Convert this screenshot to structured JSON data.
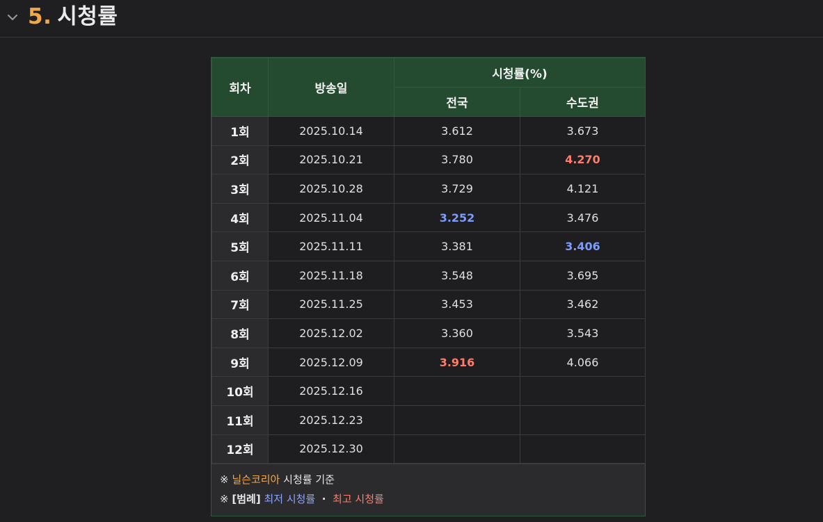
{
  "section": {
    "number": "5.",
    "title": "시청률"
  },
  "table": {
    "headers": {
      "episode": "회차",
      "air_date": "방송일",
      "rating_group": "시청률(%)",
      "nationwide": "전국",
      "metro": "수도권"
    },
    "rows": [
      {
        "episode": "1회",
        "date": "2025.10.14",
        "nationwide": "3.612",
        "nationwide_mark": "",
        "metro": "3.673",
        "metro_mark": ""
      },
      {
        "episode": "2회",
        "date": "2025.10.21",
        "nationwide": "3.780",
        "nationwide_mark": "",
        "metro": "4.270",
        "metro_mark": "high"
      },
      {
        "episode": "3회",
        "date": "2025.10.28",
        "nationwide": "3.729",
        "nationwide_mark": "",
        "metro": "4.121",
        "metro_mark": ""
      },
      {
        "episode": "4회",
        "date": "2025.11.04",
        "nationwide": "3.252",
        "nationwide_mark": "low",
        "metro": "3.476",
        "metro_mark": ""
      },
      {
        "episode": "5회",
        "date": "2025.11.11",
        "nationwide": "3.381",
        "nationwide_mark": "",
        "metro": "3.406",
        "metro_mark": "low"
      },
      {
        "episode": "6회",
        "date": "2025.11.18",
        "nationwide": "3.548",
        "nationwide_mark": "",
        "metro": "3.695",
        "metro_mark": ""
      },
      {
        "episode": "7회",
        "date": "2025.11.25",
        "nationwide": "3.453",
        "nationwide_mark": "",
        "metro": "3.462",
        "metro_mark": ""
      },
      {
        "episode": "8회",
        "date": "2025.12.02",
        "nationwide": "3.360",
        "nationwide_mark": "",
        "metro": "3.543",
        "metro_mark": ""
      },
      {
        "episode": "9회",
        "date": "2025.12.09",
        "nationwide": "3.916",
        "nationwide_mark": "high",
        "metro": "4.066",
        "metro_mark": ""
      },
      {
        "episode": "10회",
        "date": "2025.12.16",
        "nationwide": "",
        "nationwide_mark": "",
        "metro": "",
        "metro_mark": ""
      },
      {
        "episode": "11회",
        "date": "2025.12.23",
        "nationwide": "",
        "nationwide_mark": "",
        "metro": "",
        "metro_mark": ""
      },
      {
        "episode": "12회",
        "date": "2025.12.30",
        "nationwide": "",
        "nationwide_mark": "",
        "metro": "",
        "metro_mark": ""
      }
    ]
  },
  "footnote": {
    "line1_mark": "※",
    "line1_source": "닐슨코리아",
    "line1_rest": "시청률 기준",
    "line2_mark": "※",
    "line2_label": "[범례]",
    "line2_low": "최저 시청률",
    "line2_sep": "·",
    "line2_high": "최고 시청률"
  },
  "colors": {
    "accent_orange": "#f0a94a",
    "low_blue": "#7a9cff",
    "high_red": "#ff7d6b",
    "header_green": "#244a30"
  },
  "icons": {
    "collapse": "chevron-down-icon"
  }
}
